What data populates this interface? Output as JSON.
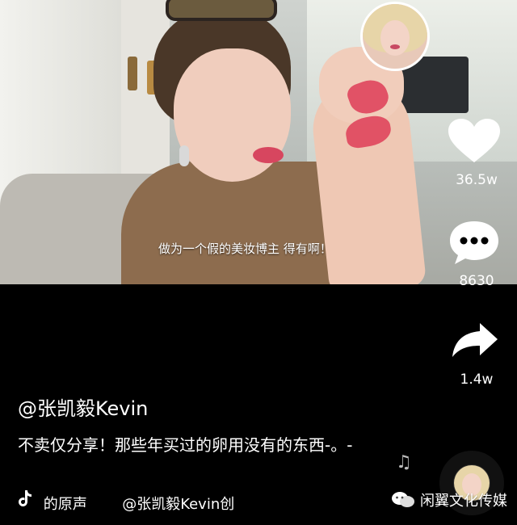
{
  "video": {
    "subtitle": "做为一个假的美妆博主 得有啊！"
  },
  "rail": {
    "like_count": "36.5w",
    "comment_count": "8630",
    "share_count": "1.4w"
  },
  "post": {
    "username": "@张凯毅Kevin",
    "caption": "不卖仅分享！那些年买过的卵用没有的东西-。-",
    "music_prefix": "的原声",
    "music_author": "@张凯毅Kevin创"
  },
  "watermark": {
    "text": "闲翼文化传媒"
  },
  "icons": [
    "avatar",
    "heart-icon",
    "comment-icon",
    "share-icon",
    "tiktok-note-icon",
    "music-note-icon",
    "wechat-icon"
  ],
  "colors": {
    "background": "#000000",
    "text": "#ffffff",
    "lipstick_swatch": "#e0485e"
  }
}
